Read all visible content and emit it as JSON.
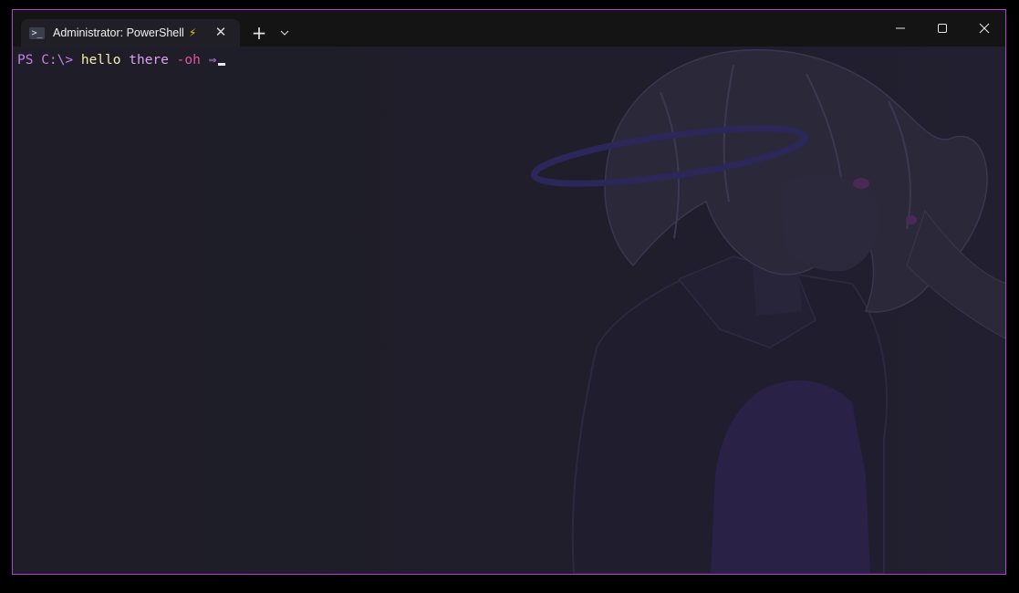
{
  "window": {
    "border_color": "#b13fd6",
    "tab": {
      "icon": "powershell-icon",
      "title": "Administrator: PowerShell",
      "badge_icon": "lightning-icon",
      "badge_glyph": "⚡",
      "close_glyph": "✕"
    },
    "new_tab_glyph": "+",
    "controls": {
      "minimize": "minimize-icon",
      "maximize": "maximize-icon",
      "close": "close-icon"
    }
  },
  "terminal": {
    "prompt": "PS C:\\> ",
    "command": "hello",
    "argument": "there",
    "parameter": "-oh",
    "trailing": "⇒",
    "colors": {
      "prompt": "#c87ee8",
      "command": "#f3f1a8",
      "argument": "#dfa0f0",
      "parameter": "#e2559f"
    }
  }
}
